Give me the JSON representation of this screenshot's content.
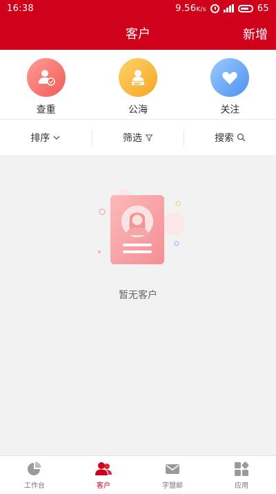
{
  "status": {
    "time": "16:38",
    "speed": "9.56",
    "speed_unit": "K/s",
    "battery": "65"
  },
  "nav": {
    "title": "客户",
    "add_label": "新增"
  },
  "quick_actions": [
    {
      "label": "查重",
      "icon": "user-check-icon",
      "color": "#f05a56"
    },
    {
      "label": "公海",
      "icon": "user-card-icon",
      "color": "#f5a623"
    },
    {
      "label": "关注",
      "icon": "heart-icon",
      "color": "#4c91f0"
    }
  ],
  "filter": {
    "sort_label": "排序",
    "filter_label": "筛选",
    "search_label": "搜索"
  },
  "empty": {
    "message": "暂无客户"
  },
  "tabs": [
    {
      "label": "工作台",
      "icon": "pie-chart-icon",
      "active": false
    },
    {
      "label": "客户",
      "icon": "contacts-icon",
      "active": true
    },
    {
      "label": "字盟邮",
      "icon": "mail-icon",
      "active": false
    },
    {
      "label": "应用",
      "icon": "apps-icon",
      "active": false
    }
  ],
  "colors": {
    "brand": "#d0021b",
    "background": "#f2f2f2"
  }
}
